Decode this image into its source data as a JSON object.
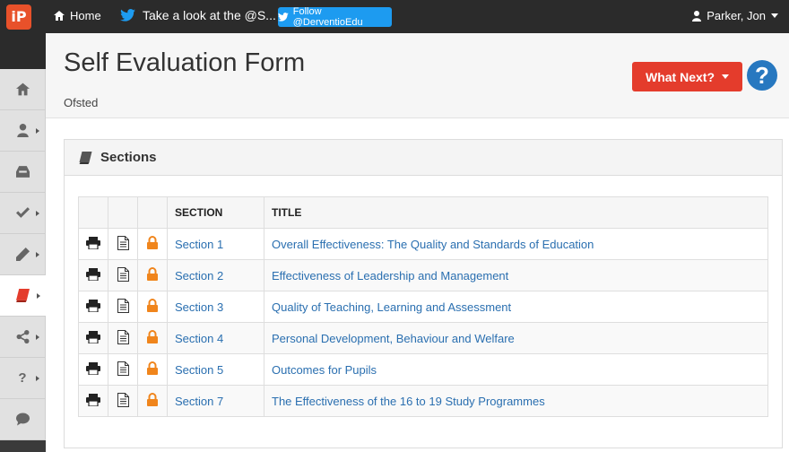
{
  "topbar": {
    "logo": "iP",
    "home": "Home",
    "tweet": "Take a look at the @S...",
    "follow": "Follow @DerventioEdu",
    "user": "Parker, Jon"
  },
  "header": {
    "title": "Self Evaluation Form",
    "subtitle": "Ofsted",
    "what_next": "What Next?",
    "help": "?"
  },
  "panel": {
    "title": "Sections",
    "columns": [
      "",
      "",
      "",
      "SECTION",
      "TITLE"
    ],
    "rows": [
      {
        "section": "Section 1",
        "title": "Overall Effectiveness: The Quality and Standards of Education"
      },
      {
        "section": "Section 2",
        "title": "Effectiveness of Leadership and Management"
      },
      {
        "section": "Section 3",
        "title": "Quality of Teaching, Learning and Assessment"
      },
      {
        "section": "Section 4",
        "title": "Personal Development, Behaviour and Welfare"
      },
      {
        "section": "Section 5",
        "title": "Outcomes for Pupils"
      },
      {
        "section": "Section 7",
        "title": "The Effectiveness of the 16 to 19 Study Programmes"
      }
    ]
  },
  "sidebar": {
    "items": [
      "home-icon",
      "user-icon",
      "inbox-icon",
      "check-icon",
      "pen-icon",
      "book-icon",
      "share-icon",
      "question-icon",
      "comment-icon"
    ],
    "active_index": 5
  },
  "colors": {
    "accent_red": "#e43c2c",
    "link_blue": "#2a6fb0",
    "lock_orange": "#f0851c"
  }
}
